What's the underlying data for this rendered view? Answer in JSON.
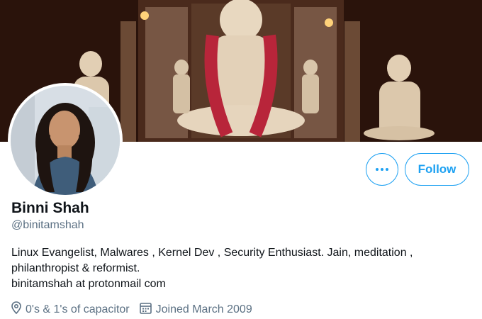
{
  "profile": {
    "name": "Binni Shah",
    "handle": "@binitamshah",
    "bio_lines": [
      "Linux Evangelist, Malwares , Kernel Dev , Security Enthusiast. Jain, meditation ,",
      "philanthropist & reformist.",
      "binitamshah at protonmail com"
    ],
    "location": "0's & 1's of capacitor",
    "joined": "Joined March 2009"
  },
  "actions": {
    "follow_label": "Follow",
    "more_icon": "more-horizontal-icon"
  },
  "icons": {
    "location": "location-pin-icon",
    "calendar": "calendar-icon"
  },
  "colors": {
    "accent": "#1da1f2",
    "text_primary": "#0f1419",
    "text_secondary": "#5b7083"
  }
}
